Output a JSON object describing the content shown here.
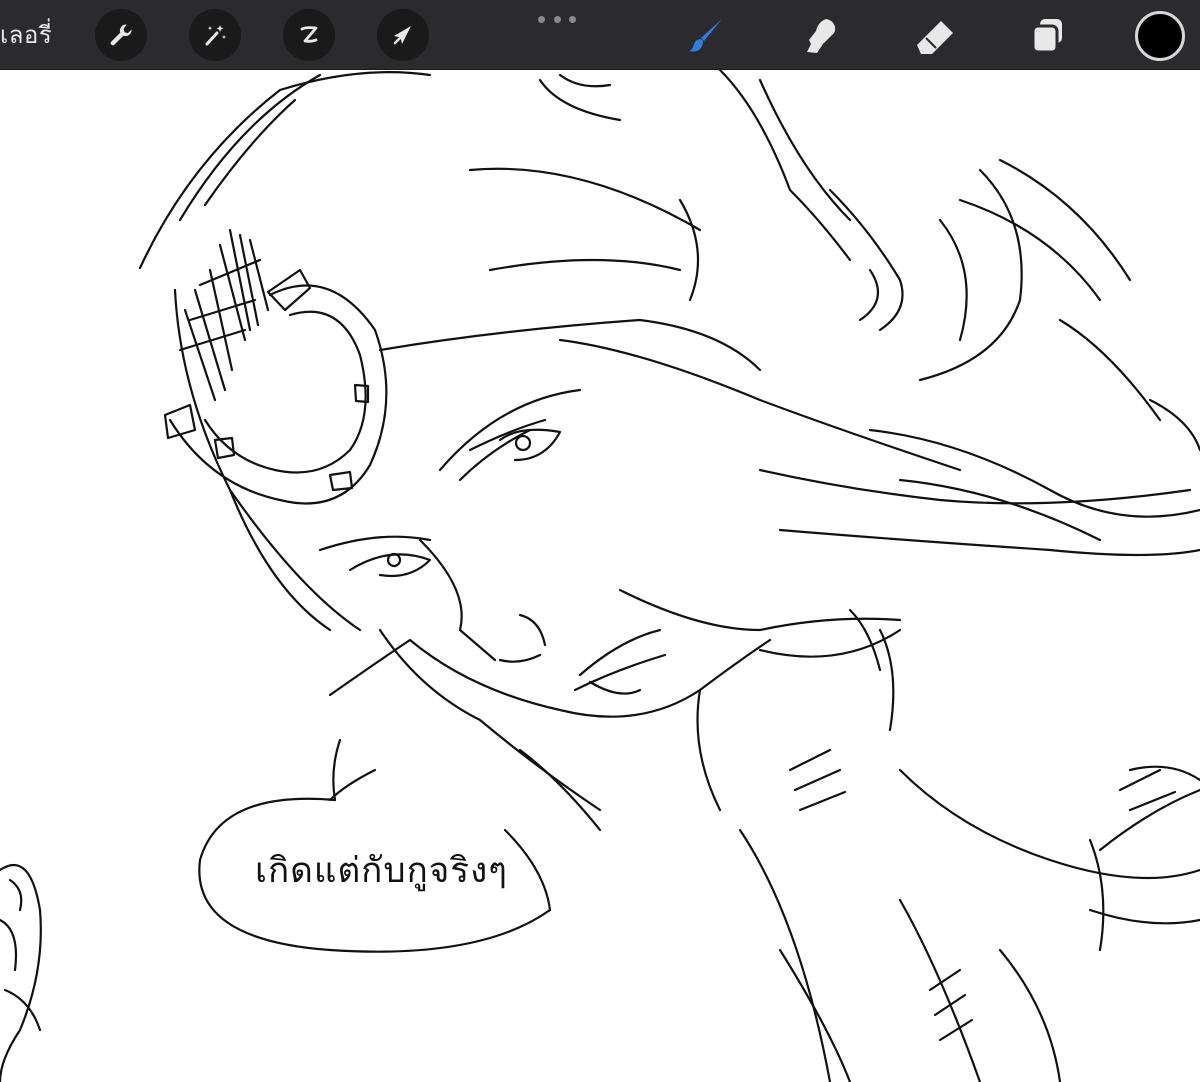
{
  "toolbar": {
    "gallery_label": "เลอรี่",
    "left_actions": [
      {
        "name": "actions-button",
        "icon": "wrench-icon"
      },
      {
        "name": "adjustments-button",
        "icon": "magic-wand-icon"
      },
      {
        "name": "selection-button",
        "icon": "selection-s-icon"
      },
      {
        "name": "transform-button",
        "icon": "arrow-cursor-icon"
      }
    ],
    "right_tools": [
      {
        "name": "brush-tool-button",
        "icon": "paintbrush-icon",
        "active": true
      },
      {
        "name": "smudge-tool-button",
        "icon": "smudge-finger-icon",
        "active": false
      },
      {
        "name": "eraser-tool-button",
        "icon": "eraser-icon",
        "active": false
      },
      {
        "name": "layers-button",
        "icon": "layers-icon",
        "active": false
      }
    ],
    "current_color": "#000000"
  },
  "canvas": {
    "speech_bubble_text": "เกิดแต่กับกูจริงๆ"
  },
  "colors": {
    "toolbar_bg": "#2b2b2d",
    "button_bg": "#1a1a1b",
    "icon_color": "#e8e8e8",
    "active_tool": "#2f7de1",
    "canvas_bg": "#ffffff",
    "ink": "#111111"
  }
}
